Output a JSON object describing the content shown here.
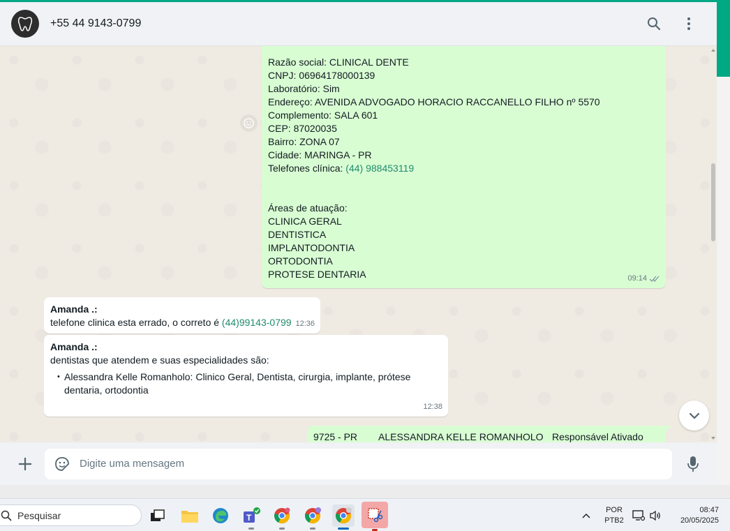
{
  "header": {
    "contact_name": "+55 44 9143-0799",
    "avatar_icon": "tooth-logo-icon",
    "icons": [
      "search-icon",
      "more-vertical-icon"
    ]
  },
  "messages": {
    "outgoing_1": {
      "lines": [
        "Razão social: CLINICAL DENTE",
        "CNPJ: 06964178000139",
        "Laboratório: Sim",
        "Endereço: AVENIDA ADVOGADO HORACIO RACCANELLO FILHO nº 5570",
        "Complemento: SALA 601",
        "CEP: 87020035",
        "Bairro: ZONA 07",
        "Cidade: MARINGA - PR"
      ],
      "phone_label": "Telefones clínica: ",
      "phone_link": "(44) 988453119",
      "areas_title": "Áreas de atuação:",
      "areas": [
        "CLINICA GERAL",
        "DENTISTICA",
        "IMPLANTODONTIA",
        "ORTODONTIA",
        "PROTESE DENTARIA"
      ],
      "time": "09:14"
    },
    "incoming_1": {
      "sender": "Amanda .:",
      "text": "telefone clinica esta errado, o correto é ",
      "link": "(44)99143-0799",
      "time": "12:36"
    },
    "incoming_2": {
      "sender": "Amanda .:",
      "text": "dentistas que atendem e suas especialidades são:",
      "bullet_line_1": "Alessandra Kelle Romanholo: Clinico Geral, Dentista, cirurgia, implante, prótese",
      "bullet_line_2": "dentaria, ortodontia",
      "time": "12:38"
    },
    "outgoing_2": {
      "col1": "9725 - PR",
      "col2": "ALESSANDRA KELLE ROMANHOLO",
      "col3": "Responsável Ativado"
    }
  },
  "composer": {
    "placeholder": "Digite uma mensagem"
  },
  "taskbar": {
    "search_label": "Pesquisar",
    "lang_top": "POR",
    "lang_bottom": "PTB2",
    "time": "08:47",
    "date": "20/05/2025"
  },
  "colors": {
    "accent": "#00a884",
    "outgoing_bubble": "#d9fdd3",
    "chat_bg": "#efeae2",
    "header_bg": "#f0f2f5"
  }
}
